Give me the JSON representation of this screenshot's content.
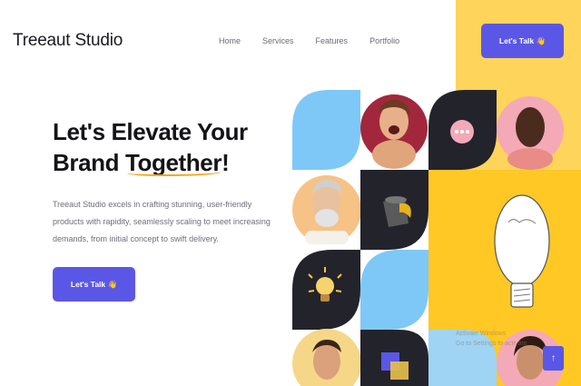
{
  "brand": {
    "name": "Treeaut Studio"
  },
  "nav": {
    "items": [
      "Home",
      "Services",
      "Features",
      "Portfolio"
    ]
  },
  "header": {
    "cta_label": "Let's Talk 👋"
  },
  "hero": {
    "headline_line1": "Let's Elevate Your",
    "headline_line2_a": "Brand ",
    "headline_line2_b": "Together",
    "headline_line2_c": "!",
    "description": "Treeaut Studio excels in crafting stunning, user-friendly products with rapidity, seamlessly scaling to meet increasing demands, from initial concept to swift delivery.",
    "cta_label": "Let's Talk 👋"
  },
  "overlay": {
    "watermark_line1": "Activate Windows",
    "watermark_line2": "Go to Settings to activate"
  },
  "scroll_top": {
    "icon": "↑"
  },
  "colors": {
    "accent": "#5b57e6",
    "yellow_panel": "#ffd45a",
    "yellow_block": "#ffc825",
    "dark": "#23232b",
    "light_blue": "#7ec8f8",
    "pink": "#f4a9b6"
  }
}
